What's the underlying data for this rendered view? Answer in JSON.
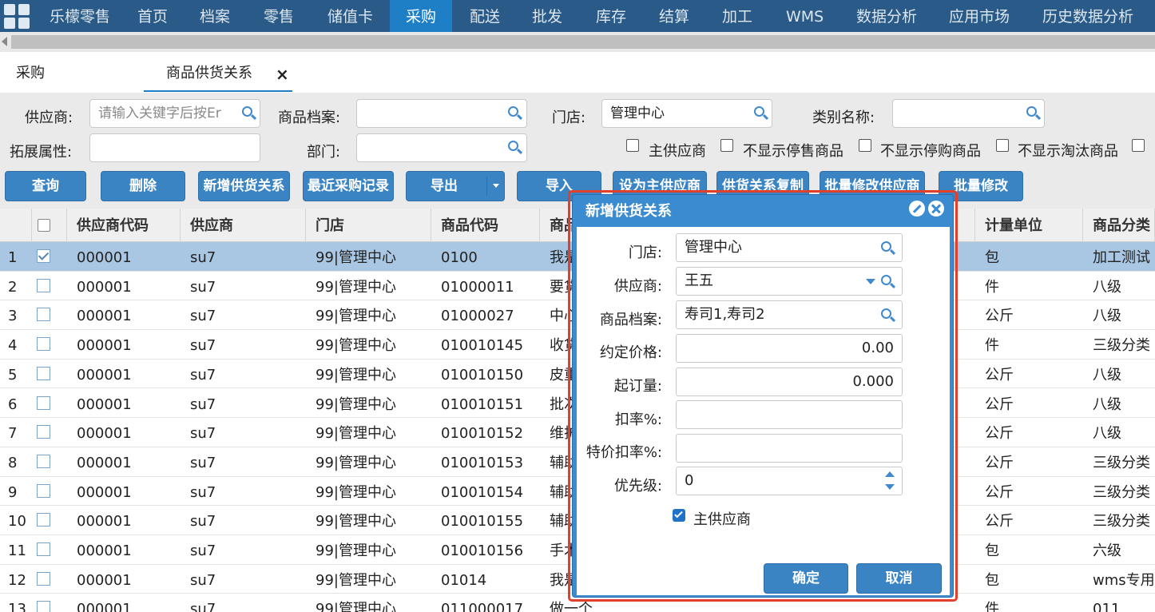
{
  "nav": {
    "items": [
      "乐檬零售",
      "首页",
      "档案",
      "零售",
      "储值卡",
      "采购",
      "配送",
      "批发",
      "库存",
      "结算",
      "加工",
      "WMS",
      "数据分析",
      "应用市场",
      "历史数据分析"
    ],
    "active": "采购"
  },
  "tabs": {
    "first": "采购",
    "second": "商品供货关系",
    "close": "×"
  },
  "filters": {
    "supplier_label": "供应商:",
    "supplier_placeholder": "请输入关键字后按Er",
    "product_label": "商品档案:",
    "product_value": "",
    "store_label": "门店:",
    "store_value": "管理中心",
    "category_label": "类别名称:",
    "category_value": "",
    "ext_label": "拓展属性:",
    "ext_value": "",
    "dept_label": "部门:",
    "dept_value": "",
    "checkboxes": [
      "主供应商",
      "不显示停售商品",
      "不显示停购商品",
      "不显示淘汰商品"
    ]
  },
  "toolbar": {
    "query": "查询",
    "delete": "删除",
    "add": "新增供货关系",
    "recent": "最近采购记录",
    "export": "导出",
    "import": "导入",
    "set_main": "设为主供应商",
    "copy": "供货关系复制",
    "batch_supplier": "批量修改供应商",
    "batch_edit": "批量修改"
  },
  "grid": {
    "headers": {
      "supplier_code": "供应商代码",
      "supplier": "供应商",
      "store": "门店",
      "product_code": "商品代码",
      "product_name": "商品",
      "unit": "计量单位",
      "category": "商品分类"
    },
    "rows": [
      {
        "n": "1",
        "code": "000001",
        "supplier": "su7",
        "store": "99|管理中心",
        "pcode": "0100",
        "pname": "我是",
        "unit": "包",
        "cat": "加工测试",
        "selected": true
      },
      {
        "n": "2",
        "code": "000001",
        "supplier": "su7",
        "store": "99|管理中心",
        "pcode": "01000011",
        "pname": "要货",
        "unit": "件",
        "cat": "八级",
        "selected": false
      },
      {
        "n": "3",
        "code": "000001",
        "supplier": "su7",
        "store": "99|管理中心",
        "pcode": "01000027",
        "pname": "中心",
        "unit": "公斤",
        "cat": "八级",
        "selected": false
      },
      {
        "n": "4",
        "code": "000001",
        "supplier": "su7",
        "store": "99|管理中心",
        "pcode": "010010145",
        "pname": "收货",
        "unit": "件",
        "cat": "三级分类",
        "selected": false
      },
      {
        "n": "5",
        "code": "000001",
        "supplier": "su7",
        "store": "99|管理中心",
        "pcode": "010010150",
        "pname": "皮重",
        "unit": "公斤",
        "cat": "八级",
        "selected": false
      },
      {
        "n": "6",
        "code": "000001",
        "supplier": "su7",
        "store": "99|管理中心",
        "pcode": "010010151",
        "pname": "批次",
        "unit": "公斤",
        "cat": "八级",
        "selected": false
      },
      {
        "n": "7",
        "code": "000001",
        "supplier": "su7",
        "store": "99|管理中心",
        "pcode": "010010152",
        "pname": "维护",
        "unit": "公斤",
        "cat": "八级",
        "selected": false
      },
      {
        "n": "8",
        "code": "000001",
        "supplier": "su7",
        "store": "99|管理中心",
        "pcode": "010010153",
        "pname": "辅助",
        "unit": "公斤",
        "cat": "三级分类",
        "selected": false
      },
      {
        "n": "9",
        "code": "000001",
        "supplier": "su7",
        "store": "99|管理中心",
        "pcode": "010010154",
        "pname": "辅助",
        "unit": "公斤",
        "cat": "三级分类",
        "selected": false
      },
      {
        "n": "10",
        "code": "000001",
        "supplier": "su7",
        "store": "99|管理中心",
        "pcode": "010010155",
        "pname": "辅助",
        "unit": "公斤",
        "cat": "三级分类",
        "selected": false
      },
      {
        "n": "11",
        "code": "000001",
        "supplier": "su7",
        "store": "99|管理中心",
        "pcode": "010010156",
        "pname": "手术",
        "unit": "包",
        "cat": "六级",
        "selected": false
      },
      {
        "n": "12",
        "code": "000001",
        "supplier": "su7",
        "store": "99|管理中心",
        "pcode": "01014",
        "pname": "我是",
        "unit": "包",
        "cat": "wms专用",
        "selected": false
      },
      {
        "n": "13",
        "code": "000001",
        "supplier": "su7",
        "store": "99|管理中心",
        "pcode": "011000017",
        "pname": "做一个",
        "unit": "件",
        "cat": "011",
        "selected": false
      }
    ]
  },
  "dialog": {
    "title": "新增供货关系",
    "store_label": "门店:",
    "store_value": "管理中心",
    "supplier_label": "供应商:",
    "supplier_value": "王五",
    "product_label": "商品档案:",
    "product_value": "寿司1,寿司2",
    "price_label": "约定价格:",
    "price_value": "0.00",
    "moq_label": "起订量:",
    "moq_value": "0.000",
    "discount_label": "扣率%:",
    "discount_value": "",
    "special_discount_label": "特价扣率%:",
    "special_discount_value": "",
    "priority_label": "优先级:",
    "priority_value": "0",
    "main_supplier_label": "主供应商",
    "main_supplier_checked": true,
    "ok": "确定",
    "cancel": "取消"
  },
  "colors": {
    "nav_bg": "#2a5a87",
    "nav_active": "#1e7fc7",
    "button": "#3a84c4",
    "selected_row": "#a9c7e3",
    "dialog_header": "#3a8bd0",
    "highlight": "#e0402c"
  }
}
